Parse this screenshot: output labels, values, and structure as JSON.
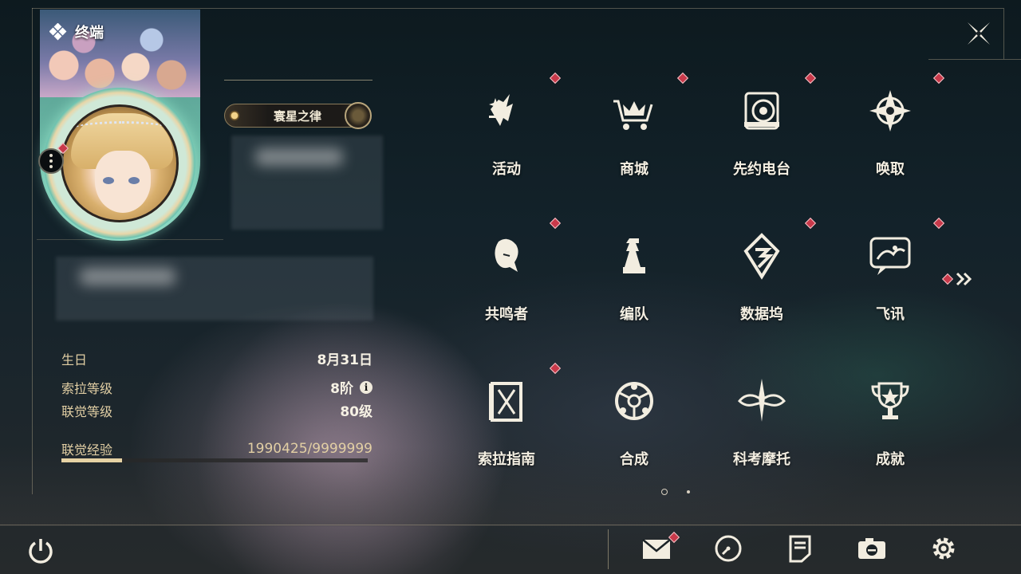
{
  "header": {
    "terminal_label": "终端"
  },
  "profile": {
    "title_badge": "寰星之律",
    "info": [
      {
        "key": "生日",
        "value": "8月31日"
      },
      {
        "key": "索拉等级",
        "value": "8阶"
      },
      {
        "key": "联觉等级",
        "value": "80级"
      }
    ],
    "exp": {
      "label": "联觉经验",
      "value": "1990425/9999999",
      "progress": 0.199
    }
  },
  "grid": {
    "items": [
      {
        "label": "活动",
        "icon": "events-icon",
        "badge": true
      },
      {
        "label": "商城",
        "icon": "shop-crown-cart-icon",
        "badge": true
      },
      {
        "label": "先约电台",
        "icon": "radio-icon",
        "badge": true
      },
      {
        "label": "唤取",
        "icon": "summon-compass-icon",
        "badge": true
      },
      {
        "label": "共鸣者",
        "icon": "resonator-head-icon",
        "badge": true
      },
      {
        "label": "编队",
        "icon": "team-chess-icon",
        "badge": false
      },
      {
        "label": "数据坞",
        "icon": "data-dock-icon",
        "badge": true
      },
      {
        "label": "飞讯",
        "icon": "messenger-icon",
        "badge": true
      },
      {
        "label": "索拉指南",
        "icon": "guide-book-icon",
        "badge": true
      },
      {
        "label": "合成",
        "icon": "synthesis-icon",
        "badge": false
      },
      {
        "label": "科考摩托",
        "icon": "motorcycle-icon",
        "badge": false
      },
      {
        "label": "成就",
        "icon": "trophy-icon",
        "badge": false
      }
    ],
    "pages": 2,
    "current_page": 1
  },
  "dock": {
    "buttons": [
      "mail-icon",
      "clock-icon",
      "notes-icon",
      "camera-icon",
      "settings-gear-icon"
    ]
  },
  "colors": {
    "accent_gold": "#e6d2a4",
    "badge_red": "#c8394a",
    "text": "#f4efe2"
  }
}
